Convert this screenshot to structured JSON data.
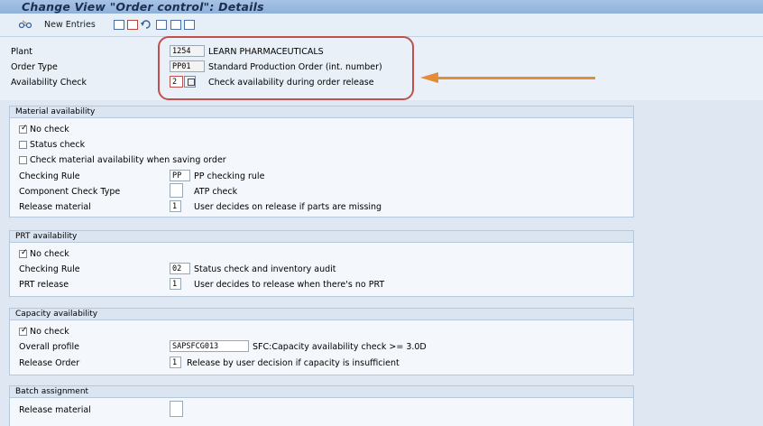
{
  "title": "Change View \"Order control\": Details",
  "toolbar": {
    "new_entries": "New Entries"
  },
  "header": {
    "plant_label": "Plant",
    "plant_value": "1254",
    "plant_desc": "LEARN PHARMACEUTICALS",
    "order_type_label": "Order Type",
    "order_type_value": "PP01",
    "order_type_desc": "Standard Production Order (int. number)",
    "availability_label": "Availability Check",
    "availability_value": "2",
    "availability_desc": "Check availability during order release"
  },
  "material": {
    "heading": "Material availability",
    "no_check": "No check",
    "no_check_checked": true,
    "status_check": "Status check",
    "status_check_checked": false,
    "saving_check": "Check material availability when saving order",
    "saving_check_checked": false,
    "checking_rule_label": "Checking Rule",
    "checking_rule_value": "PP",
    "checking_rule_desc": "PP checking rule",
    "component_label": "Component Check Type",
    "component_value": "",
    "component_desc": "ATP check",
    "release_label": "Release material",
    "release_value": "1",
    "release_desc": "User decides on release if parts are missing"
  },
  "prt": {
    "heading": "PRT availability",
    "no_check": "No check",
    "no_check_checked": true,
    "checking_rule_label": "Checking Rule",
    "checking_rule_value": "02",
    "checking_rule_desc": "Status check and inventory audit",
    "release_label": "PRT release",
    "release_value": "1",
    "release_desc": "User decides to release when there's no PRT"
  },
  "capacity": {
    "heading": "Capacity availability",
    "no_check": "No check",
    "no_check_checked": true,
    "profile_label": "Overall profile",
    "profile_value": "SAPSFCG013",
    "profile_desc": "SFC:Capacity availability check >= 3.0D",
    "release_label": "Release Order",
    "release_value": "1",
    "release_desc": "Release by user decision if capacity is insufficient"
  },
  "batch": {
    "heading": "Batch assignment",
    "release_label": "Release material",
    "release_value": ""
  },
  "colors": {
    "annotation_box": "#c0504d",
    "annotation_arrow": "#e38d37"
  }
}
